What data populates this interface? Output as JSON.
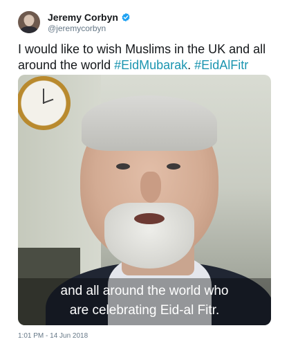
{
  "author": {
    "display_name": "Jeremy Corbyn",
    "handle": "@jeremycorbyn",
    "verified": true,
    "avatar_icon": "profile-photo"
  },
  "tweet": {
    "text_prefix": "I would like to wish Muslims in the UK and all around the world ",
    "hashtag1": "#EidMubarak",
    "separator": ". ",
    "hashtag2": "#EidAlFitr",
    "hashtag_color": "#1b95b0"
  },
  "media": {
    "caption_line1": "and all around the world who",
    "caption_line2": "are celebrating Eid-al Fitr."
  },
  "timestamp": "1:01 PM - 14 Jun 2018",
  "colors": {
    "verified_badge": "#1da1f2",
    "secondary_text": "#657786"
  }
}
